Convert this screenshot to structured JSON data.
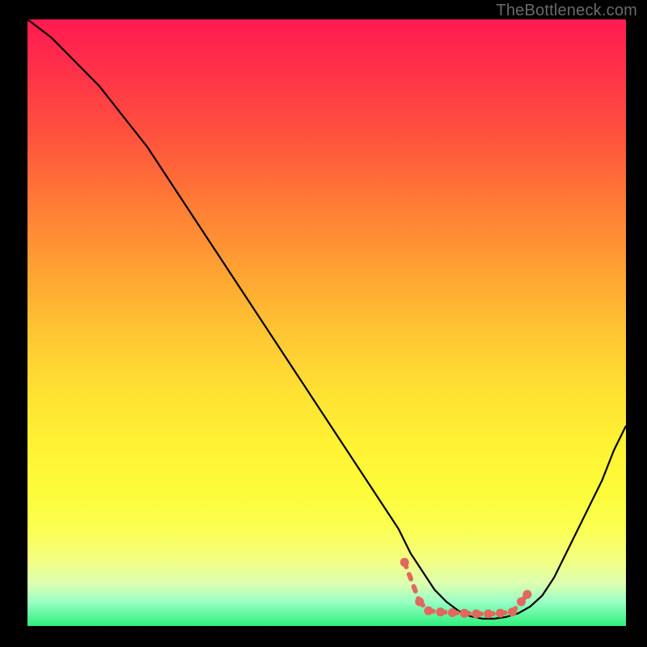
{
  "watermark": "TheBottleneck.com",
  "chart_data": {
    "type": "line",
    "title": "",
    "xlabel": "",
    "ylabel": "",
    "xlim": [
      0,
      100
    ],
    "ylim": [
      0,
      100
    ],
    "grid": false,
    "legend": false,
    "series": [
      {
        "name": "curve",
        "x": [
          0,
          4,
          8,
          12,
          16,
          20,
          24,
          28,
          32,
          36,
          40,
          44,
          48,
          52,
          56,
          60,
          62,
          64,
          66,
          68,
          70,
          72,
          74,
          76,
          78,
          80,
          82,
          84,
          86,
          88,
          90,
          92,
          94,
          96,
          98,
          100
        ],
        "y": [
          100,
          97,
          93,
          89,
          84,
          79,
          73,
          67,
          61,
          55,
          49,
          43,
          37,
          31,
          25,
          19,
          16,
          12,
          9,
          6,
          4,
          2.5,
          1.6,
          1.2,
          1.2,
          1.5,
          2.1,
          3.2,
          5,
          8,
          12,
          16,
          20,
          24,
          29,
          33
        ]
      },
      {
        "name": "markers",
        "x": [
          63,
          65.5,
          67,
          69,
          71,
          73,
          75,
          77,
          79,
          81,
          82.5,
          83.5
        ],
        "y": [
          10.5,
          4.0,
          2.5,
          2.3,
          2.2,
          2.1,
          2.0,
          2.0,
          2.1,
          2.3,
          4.0,
          5.2
        ]
      }
    ],
    "background_gradient": {
      "top": "#ff1a50",
      "mid": "#fff233",
      "bottom": "#2ef07a"
    }
  }
}
